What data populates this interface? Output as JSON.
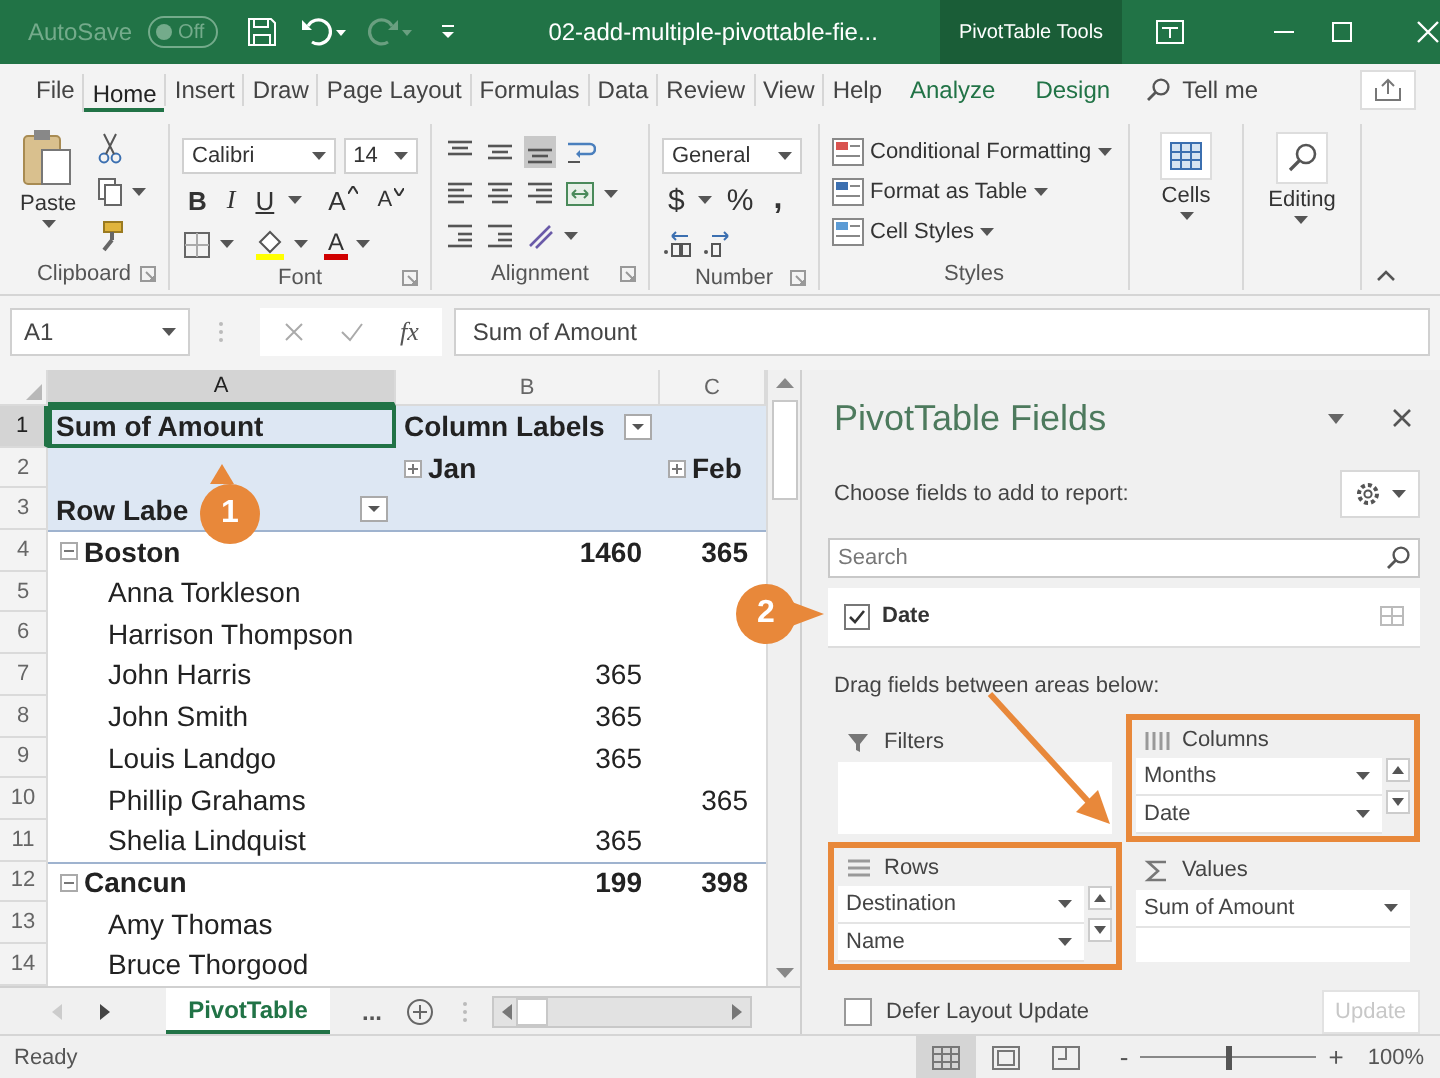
{
  "title_bar": {
    "autosave_label": "AutoSave",
    "autosave_on": false,
    "autosave_state": "Off",
    "document_title": "02-add-multiple-pivottable-fie...",
    "context_tab": "PivotTable Tools"
  },
  "ribbon_tabs": [
    {
      "label": "File",
      "selected": false,
      "kind": "standard"
    },
    {
      "label": "Home",
      "selected": true,
      "kind": "standard"
    },
    {
      "label": "Insert",
      "selected": false,
      "kind": "standard"
    },
    {
      "label": "Draw",
      "selected": false,
      "kind": "standard"
    },
    {
      "label": "Page Layout",
      "selected": false,
      "kind": "standard"
    },
    {
      "label": "Formulas",
      "selected": false,
      "kind": "standard"
    },
    {
      "label": "Data",
      "selected": false,
      "kind": "standard"
    },
    {
      "label": "Review",
      "selected": false,
      "kind": "standard"
    },
    {
      "label": "View",
      "selected": false,
      "kind": "standard"
    },
    {
      "label": "Help",
      "selected": false,
      "kind": "standard"
    },
    {
      "label": "Analyze",
      "selected": false,
      "kind": "contextual"
    },
    {
      "label": "Design",
      "selected": false,
      "kind": "contextual"
    }
  ],
  "tell_me": "Tell me",
  "ribbon": {
    "clipboard": {
      "label": "Clipboard",
      "paste": "Paste"
    },
    "font": {
      "label": "Font",
      "font_name": "Calibri",
      "font_size": "14",
      "bold": "B",
      "italic": "I",
      "underline": "U",
      "grow": "A",
      "shrink": "A",
      "font_color": "A"
    },
    "alignment": {
      "label": "Alignment",
      "vertical": [
        {
          "kind": "top",
          "selected": false
        },
        {
          "kind": "middle",
          "selected": false
        },
        {
          "kind": "bottom",
          "selected": true
        }
      ]
    },
    "number": {
      "label": "Number",
      "format": "General",
      "currency": "$",
      "percent": "%",
      "comma": ","
    },
    "styles": {
      "label": "Styles",
      "items": [
        "Conditional Formatting",
        "Format as Table",
        "Cell Styles"
      ]
    },
    "cells": {
      "label": "Cells"
    },
    "editing": {
      "label": "Editing"
    }
  },
  "formula_bar": {
    "name_box": "A1",
    "function_label": "fx",
    "formula": "Sum of Amount"
  },
  "sheet": {
    "columns": [
      {
        "label": "A",
        "selected": true
      },
      {
        "label": "B",
        "selected": false
      },
      {
        "label": "C",
        "selected": false
      }
    ],
    "rows": [
      {
        "number": "1",
        "selected": true,
        "kind": "header",
        "a": {
          "text": "Sum of Amount"
        },
        "b": {
          "text": "Column Labels",
          "filter_button": true
        }
      },
      {
        "number": "2",
        "selected": false,
        "kind": "header",
        "b": {
          "text": "Jan",
          "expanded": false
        },
        "c": {
          "text": "Feb",
          "expanded": false
        }
      },
      {
        "number": "3",
        "selected": false,
        "kind": "header",
        "a": {
          "text": "Row Labe",
          "filter_button": true
        }
      },
      {
        "number": "4",
        "selected": false,
        "kind": "group",
        "a": {
          "text": "Boston",
          "expanded": true
        },
        "b": {
          "text": "1460"
        },
        "c": {
          "text": "365"
        }
      },
      {
        "number": "5",
        "selected": false,
        "kind": "item",
        "a": {
          "text": "Anna Torkleson"
        }
      },
      {
        "number": "6",
        "selected": false,
        "kind": "item",
        "a": {
          "text": "Harrison Thompson"
        }
      },
      {
        "number": "7",
        "selected": false,
        "kind": "item",
        "a": {
          "text": "John Harris"
        },
        "b": {
          "text": "365"
        }
      },
      {
        "number": "8",
        "selected": false,
        "kind": "item",
        "a": {
          "text": "John Smith"
        },
        "b": {
          "text": "365"
        }
      },
      {
        "number": "9",
        "selected": false,
        "kind": "item",
        "a": {
          "text": "Louis Landgo"
        },
        "b": {
          "text": "365"
        }
      },
      {
        "number": "10",
        "selected": false,
        "kind": "item",
        "a": {
          "text": "Phillip Grahams"
        },
        "c": {
          "text": "365"
        }
      },
      {
        "number": "11",
        "selected": false,
        "kind": "item",
        "a": {
          "text": "Shelia Lindquist"
        },
        "b": {
          "text": "365"
        }
      },
      {
        "number": "12",
        "selected": false,
        "kind": "group",
        "a": {
          "text": "Cancun",
          "expanded": true
        },
        "b": {
          "text": "199"
        },
        "c": {
          "text": "398"
        }
      },
      {
        "number": "13",
        "selected": false,
        "kind": "item",
        "a": {
          "text": "Amy Thomas"
        }
      },
      {
        "number": "14",
        "selected": false,
        "kind": "item",
        "a": {
          "text": "Bruce Thorgood"
        }
      }
    ]
  },
  "sheet_tabs": {
    "tabs": [
      {
        "label": "PivotTable",
        "selected": true
      }
    ],
    "more": "..."
  },
  "pivot_pane": {
    "title": "PivotTable Fields",
    "subtitle": "Choose fields to add to report:",
    "search": {
      "placeholder": "Search"
    },
    "fields": [
      {
        "label": "Date",
        "checked": true
      }
    ],
    "drag_hint": "Drag fields between areas below:",
    "areas": [
      {
        "kind": "filters",
        "label": "Filters",
        "highlighted": false
      },
      {
        "kind": "columns",
        "label": "Columns",
        "highlighted": true,
        "items": [
          "Months",
          "Date"
        ]
      },
      {
        "kind": "rows",
        "label": "Rows",
        "highlighted": true,
        "items": [
          "Destination",
          "Name"
        ]
      },
      {
        "kind": "values",
        "label": "Values",
        "highlighted": false,
        "items": [
          "Sum of Amount"
        ]
      }
    ],
    "defer_update": {
      "label": "Defer Layout Update",
      "checked": false
    },
    "update_button": {
      "label": "Update",
      "disabled": true
    }
  },
  "status_bar": {
    "status": "Ready",
    "views": [
      {
        "kind": "normal",
        "selected": true
      },
      {
        "kind": "page_layout",
        "selected": false
      },
      {
        "kind": "page_break",
        "selected": false
      }
    ],
    "zoom_out": "-",
    "zoom_slider": {
      "level": 0.5
    },
    "zoom_in": "+",
    "zoom": "100%"
  },
  "callouts": [
    {
      "number": "1"
    },
    {
      "number": "2"
    }
  ]
}
